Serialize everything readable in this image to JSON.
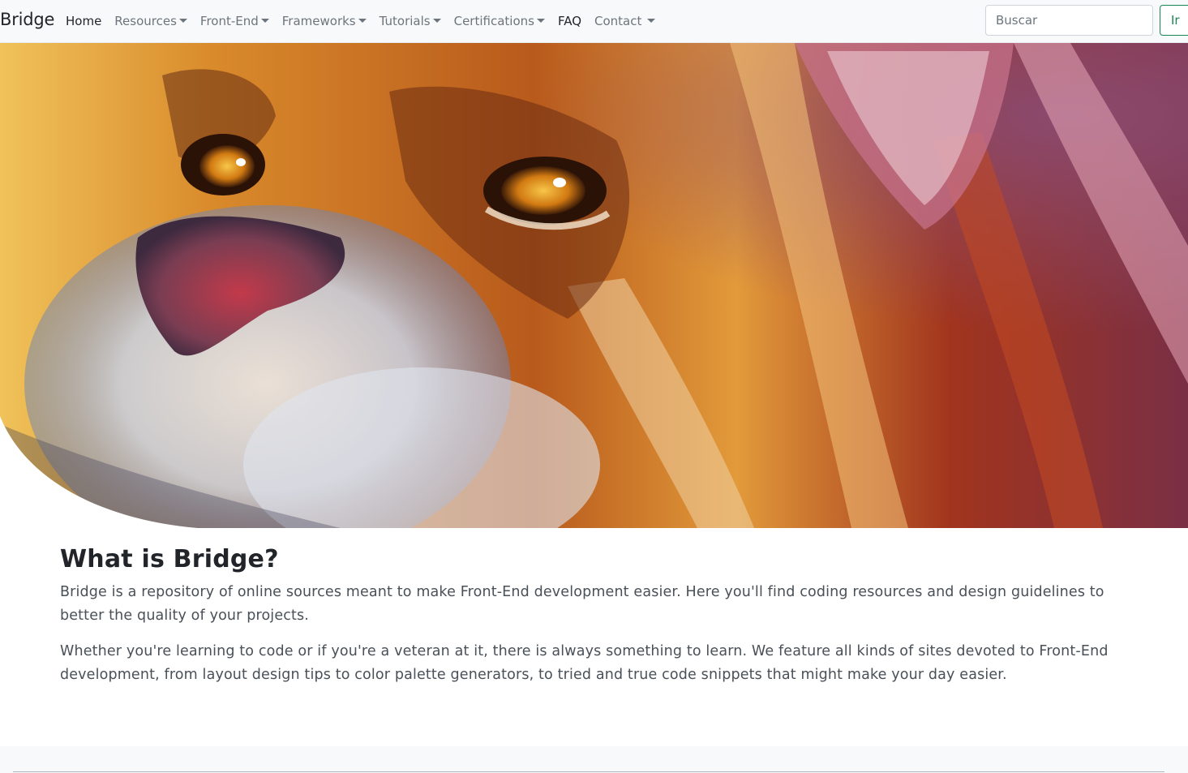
{
  "navbar": {
    "brand": "Bridge",
    "items": [
      {
        "label": "Home",
        "dropdown": false,
        "active": true
      },
      {
        "label": "Resources",
        "dropdown": true
      },
      {
        "label": "Front-End",
        "dropdown": true
      },
      {
        "label": "Frameworks",
        "dropdown": true
      },
      {
        "label": "Tutorials",
        "dropdown": true
      },
      {
        "label": "Certifications",
        "dropdown": true
      },
      {
        "label": "FAQ",
        "dropdown": false
      },
      {
        "label": "Contact",
        "dropdown": true
      }
    ],
    "search": {
      "placeholder": "Buscar",
      "button_label": "Ir"
    }
  },
  "hero": {
    "image": "watercolor-lion-illustration"
  },
  "content": {
    "heading": "What is Bridge?",
    "paragraphs": [
      "Bridge is a repository of online sources meant to make Front-End development easier. Here you'll find coding resources and design guidelines to better the quality of your projects.",
      "Whether you're learning to code or if you're a veteran at it, there is always something to learn. We feature all kinds of sites devoted to Front-End development, from layout design tips to color palette generators, to tried and true code snippets that might make your day easier."
    ]
  },
  "colors": {
    "navbar_bg": "#f8f9fa",
    "search_button": "#198754",
    "heading": "#212529",
    "body_text": "#495057"
  }
}
